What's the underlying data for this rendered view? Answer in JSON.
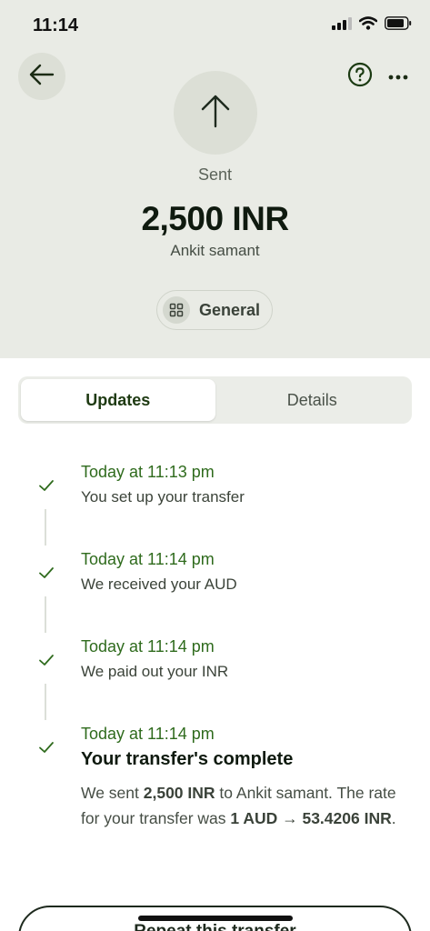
{
  "status_bar": {
    "time": "11:14",
    "icons": [
      "cellular-signal-icon",
      "wifi-icon",
      "battery-icon"
    ]
  },
  "header": {
    "back_icon": "arrow-left-icon",
    "help_icon": "question-circle-icon",
    "more_icon": "ellipsis-icon",
    "direction_icon": "arrow-up-icon",
    "status_label": "Sent",
    "amount": "2,500 INR",
    "recipient": "Ankit samant",
    "category": {
      "icon": "grid-icon",
      "label": "General"
    }
  },
  "tabs": [
    {
      "label": "Updates",
      "active": true
    },
    {
      "label": "Details",
      "active": false
    }
  ],
  "timeline": [
    {
      "time": "Today at 11:13 pm",
      "description": "You set up your transfer"
    },
    {
      "time": "Today at 11:14 pm",
      "description": "We received your AUD"
    },
    {
      "time": "Today at 11:14 pm",
      "description": "We paid out your INR"
    },
    {
      "time": "Today at 11:14 pm",
      "title": "Your transfer's complete",
      "body": {
        "p1": "We sent ",
        "amount": "2,500 INR",
        "p2": " to Ankit samant. The rate for your transfer was ",
        "rate": "1 AUD → 53.4206 INR",
        "p3": "."
      }
    }
  ],
  "actions": {
    "repeat_label": "Repeat this transfer"
  },
  "colors": {
    "header_bg": "#e9ebe5",
    "accent_green": "#2f6b1d",
    "active_tab_text": "#1e3a12"
  }
}
